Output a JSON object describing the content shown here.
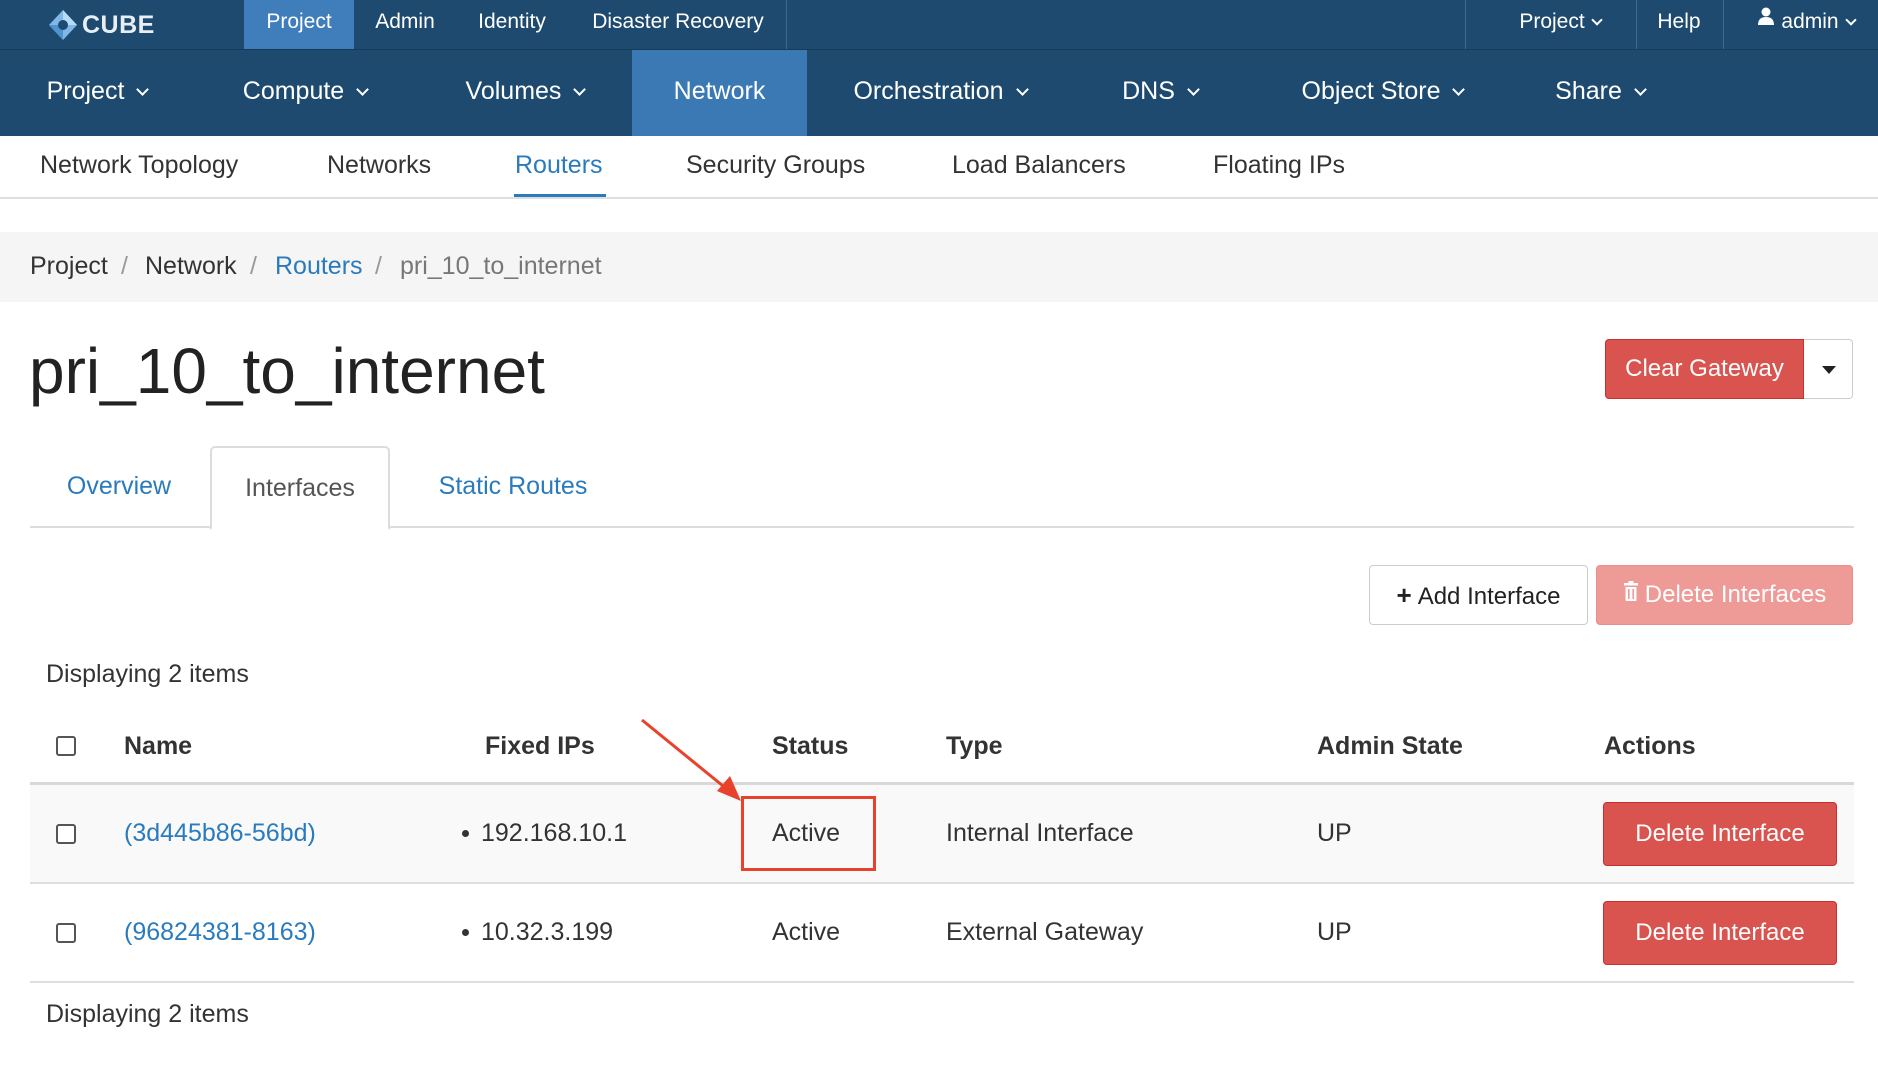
{
  "topbar": {
    "brand": "CUBE",
    "items": [
      "Project",
      "Admin",
      "Identity",
      "Disaster Recovery"
    ],
    "right": {
      "project": "Project",
      "help": "Help",
      "user": "admin"
    }
  },
  "mainnav": {
    "items": [
      "Project",
      "Compute",
      "Volumes",
      "Network",
      "Orchestration",
      "DNS",
      "Object Store",
      "Share"
    ]
  },
  "subnav": {
    "items": [
      "Network Topology",
      "Networks",
      "Routers",
      "Security Groups",
      "Load Balancers",
      "Floating IPs"
    ]
  },
  "breadcrumb": [
    "Project",
    "Network",
    "Routers",
    "pri_10_to_internet"
  ],
  "page": {
    "title": "pri_10_to_internet",
    "clear_gateway": "Clear Gateway"
  },
  "tabs": [
    "Overview",
    "Interfaces",
    "Static Routes"
  ],
  "table_actions": {
    "add": "Add Interface",
    "delete": "Delete Interfaces"
  },
  "table": {
    "count_text": "Displaying 2 items",
    "headers": [
      "Name",
      "Fixed IPs",
      "Status",
      "Type",
      "Admin State",
      "Actions"
    ],
    "rows": [
      {
        "name": "(3d445b86-56bd)",
        "ip": "192.168.10.1",
        "status": "Active",
        "type": "Internal Interface",
        "admin_state": "UP",
        "action": "Delete Interface"
      },
      {
        "name": "(96824381-8163)",
        "ip": "10.32.3.199",
        "status": "Active",
        "type": "External Gateway",
        "admin_state": "UP",
        "action": "Delete Interface"
      }
    ]
  },
  "colors": {
    "nav_bg": "#1d4a6e",
    "nav_active": "#3b79b4",
    "link": "#2a7bbd",
    "danger": "#d9534f",
    "annotation": "#e8412c"
  }
}
